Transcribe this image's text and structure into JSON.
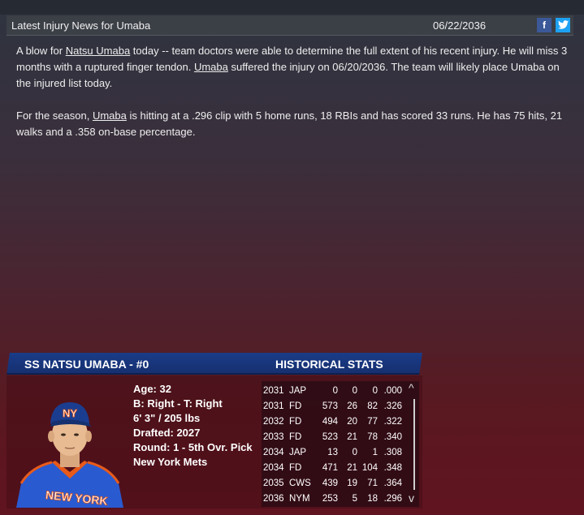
{
  "news": {
    "title": "Latest Injury News for Umaba",
    "date": "06/22/2036",
    "facebook_label": "f",
    "twitter_label": "🐦"
  },
  "article": {
    "p1_a": "A blow for ",
    "p1_link_name": "Natsu Umaba",
    "p1_b": " today -- team doctors were able to determine the full extent of his recent injury. He will miss 3 months with a ruptured finger tendon. ",
    "p1_link_last": "Umaba",
    "p1_c": " suffered the injury on 06/20/2036. The team will likely place Umaba on the injured list today.",
    "p2_a": "For the season, ",
    "p2_link_last": "Umaba",
    "p2_b": " is hitting at a .296 clip with 5 home runs, 18 RBIs and has scored 33 runs. He has 75 hits, 21 walks and a .358 on-base percentage."
  },
  "player": {
    "title": "SS NATSU UMABA - #0",
    "age": "Age: 32",
    "bats_throws": "B: Right - T: Right",
    "height_weight": "6' 3\" / 205 lbs",
    "drafted": "Drafted: 2027",
    "round": "Round: 1 - 5th Ovr. Pick",
    "team": "New York Mets"
  },
  "historical": {
    "title": "HISTORICAL STATS",
    "rows": [
      {
        "year": "2031",
        "team": "JAP",
        "ab": "0",
        "hr": "0",
        "rbi": "0",
        "avg": ".000"
      },
      {
        "year": "2031",
        "team": "FD",
        "ab": "573",
        "hr": "26",
        "rbi": "82",
        "avg": ".326"
      },
      {
        "year": "2032",
        "team": "FD",
        "ab": "494",
        "hr": "20",
        "rbi": "77",
        "avg": ".322"
      },
      {
        "year": "2033",
        "team": "FD",
        "ab": "523",
        "hr": "21",
        "rbi": "78",
        "avg": ".340"
      },
      {
        "year": "2034",
        "team": "JAP",
        "ab": "13",
        "hr": "0",
        "rbi": "1",
        "avg": ".308"
      },
      {
        "year": "2034",
        "team": "FD",
        "ab": "471",
        "hr": "21",
        "rbi": "104",
        "avg": ".348"
      },
      {
        "year": "2035",
        "team": "CWS",
        "ab": "439",
        "hr": "19",
        "rbi": "71",
        "avg": ".364"
      },
      {
        "year": "2036",
        "team": "NYM",
        "ab": "253",
        "hr": "5",
        "rbi": "18",
        "avg": ".296"
      }
    ]
  },
  "colors": {
    "header_blue": "#1a3c88",
    "facebook": "#3b5998",
    "twitter": "#1da1f2"
  }
}
